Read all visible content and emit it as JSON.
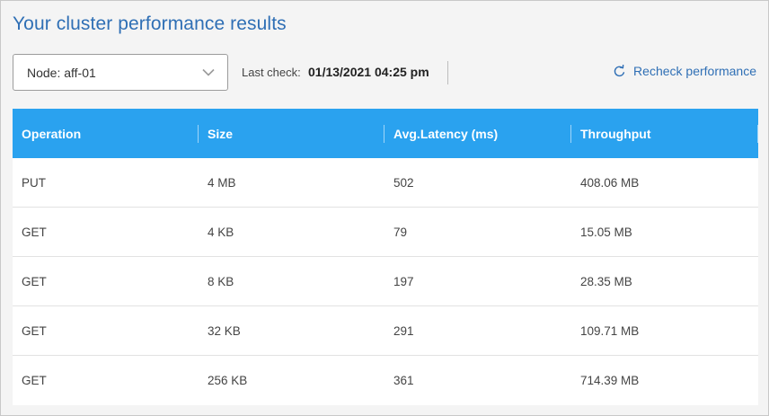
{
  "page": {
    "title": "Your cluster performance results"
  },
  "node_select": {
    "value": "Node: aff-01"
  },
  "last_check": {
    "label": "Last check:",
    "value": "01/13/2021 04:25 pm"
  },
  "recheck": {
    "label": "Recheck performance"
  },
  "table": {
    "headers": [
      "Operation",
      "Size",
      "Avg.Latency (ms)",
      "Throughput"
    ],
    "rows": [
      [
        "PUT",
        "4 MB",
        "502",
        "408.06 MB"
      ],
      [
        "GET",
        "4 KB",
        "79",
        "15.05 MB"
      ],
      [
        "GET",
        "8 KB",
        "197",
        "28.35 MB"
      ],
      [
        "GET",
        "32 KB",
        "291",
        "109.71 MB"
      ],
      [
        "GET",
        "256 KB",
        "361",
        "714.39 MB"
      ]
    ]
  },
  "colors": {
    "accent": "#2f6fb5",
    "header_bg": "#2aa2ef",
    "page_bg": "#f4f4f4"
  },
  "icons": {
    "select": "chevron-down-icon",
    "recheck": "refresh-icon"
  }
}
